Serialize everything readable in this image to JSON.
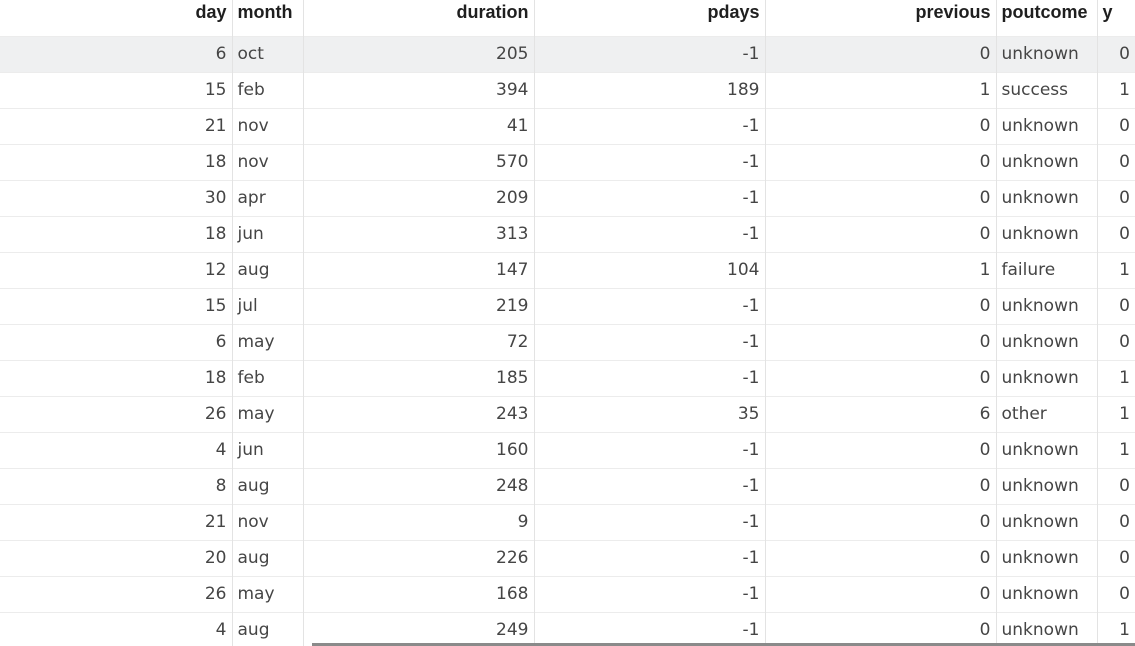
{
  "columns": [
    "day",
    "month",
    "duration",
    "pdays",
    "previous",
    "poutcome",
    "y"
  ],
  "rows": [
    [
      "6",
      "oct",
      "205",
      "-1",
      "0",
      "unknown",
      "0"
    ],
    [
      "15",
      "feb",
      "394",
      "189",
      "1",
      "success",
      "1"
    ],
    [
      "21",
      "nov",
      "41",
      "-1",
      "0",
      "unknown",
      "0"
    ],
    [
      "18",
      "nov",
      "570",
      "-1",
      "0",
      "unknown",
      "0"
    ],
    [
      "30",
      "apr",
      "209",
      "-1",
      "0",
      "unknown",
      "0"
    ],
    [
      "18",
      "jun",
      "313",
      "-1",
      "0",
      "unknown",
      "0"
    ],
    [
      "12",
      "aug",
      "147",
      "104",
      "1",
      "failure",
      "1"
    ],
    [
      "15",
      "jul",
      "219",
      "-1",
      "0",
      "unknown",
      "0"
    ],
    [
      "6",
      "may",
      "72",
      "-1",
      "0",
      "unknown",
      "0"
    ],
    [
      "18",
      "feb",
      "185",
      "-1",
      "0",
      "unknown",
      "1"
    ],
    [
      "26",
      "may",
      "243",
      "35",
      "6",
      "other",
      "1"
    ],
    [
      "4",
      "jun",
      "160",
      "-1",
      "0",
      "unknown",
      "1"
    ],
    [
      "8",
      "aug",
      "248",
      "-1",
      "0",
      "unknown",
      "0"
    ],
    [
      "21",
      "nov",
      "9",
      "-1",
      "0",
      "unknown",
      "0"
    ],
    [
      "20",
      "aug",
      "226",
      "-1",
      "0",
      "unknown",
      "0"
    ],
    [
      "26",
      "may",
      "168",
      "-1",
      "0",
      "unknown",
      "0"
    ],
    [
      "4",
      "aug",
      "249",
      "-1",
      "0",
      "unknown",
      "1"
    ]
  ],
  "selected_row": 0
}
